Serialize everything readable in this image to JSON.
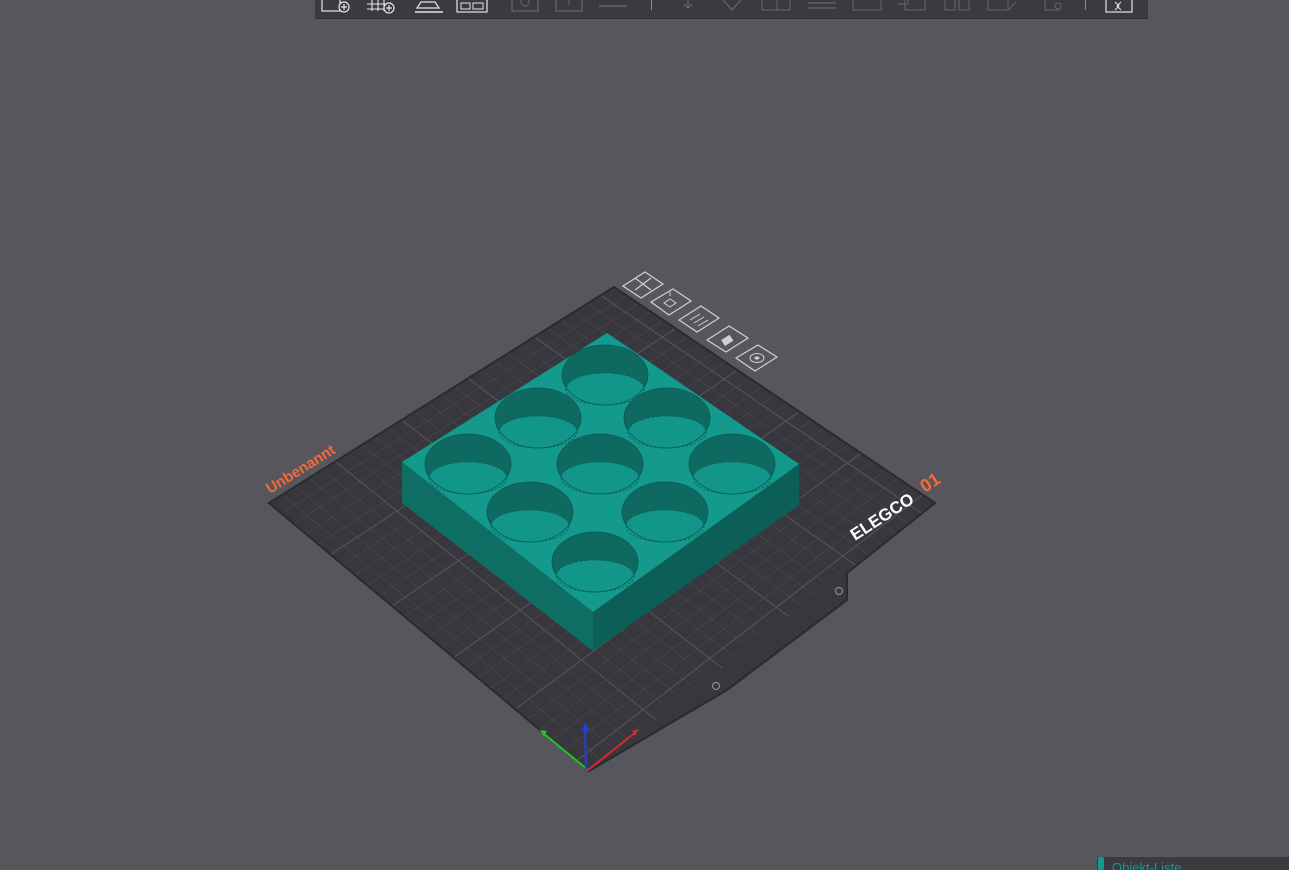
{
  "toolbar": {
    "buttons": [
      {
        "id": "add-object",
        "icon": "add-object-icon",
        "enabled": true
      },
      {
        "id": "add-plate",
        "icon": "add-plate-icon",
        "enabled": true
      },
      {
        "id": "auto-orient",
        "icon": "auto-orient-icon",
        "enabled": true
      },
      {
        "id": "arrange",
        "icon": "arrange-icon",
        "enabled": true
      },
      {
        "id": "add-instance",
        "icon": "add-instance-icon",
        "enabled": false
      },
      {
        "id": "remove-instance",
        "icon": "remove-instance-icon",
        "enabled": false
      },
      {
        "id": "split",
        "icon": "split-icon",
        "enabled": false
      },
      {
        "id": "move",
        "icon": "move-icon",
        "enabled": false
      },
      {
        "id": "rotate",
        "icon": "rotate-icon",
        "enabled": false
      },
      {
        "id": "scale",
        "icon": "scale-icon",
        "enabled": false
      },
      {
        "id": "lay-on-face",
        "icon": "lay-on-face-icon",
        "enabled": false
      },
      {
        "id": "cut",
        "icon": "cut-icon",
        "enabled": false
      },
      {
        "id": "support-paint",
        "icon": "support-paint-icon",
        "enabled": false
      },
      {
        "id": "seam-paint",
        "icon": "seam-paint-icon",
        "enabled": false
      },
      {
        "id": "color-paint",
        "icon": "color-paint-icon",
        "enabled": false
      },
      {
        "id": "text",
        "icon": "text-icon",
        "enabled": false
      },
      {
        "id": "assembly-view",
        "icon": "assembly-view-icon",
        "enabled": true
      }
    ]
  },
  "plate": {
    "name": "Unbenannt",
    "brand": "ELEGCO",
    "number": "01",
    "colors": {
      "plate": "#38373d",
      "grid": "#4a4950",
      "label": "#f26b3a",
      "brand": "#ffffff"
    }
  },
  "plate_tools": [
    {
      "id": "delete-plate",
      "icon": "close-icon"
    },
    {
      "id": "orient-plate",
      "icon": "orient-icon"
    },
    {
      "id": "arrange-plate",
      "icon": "arrange-icon"
    },
    {
      "id": "lock-plate",
      "icon": "lock-icon"
    },
    {
      "id": "plate-settings",
      "icon": "settings-icon"
    }
  ],
  "model": {
    "color": "#139a8c",
    "holes": 9
  },
  "object_list": {
    "label": "Objekt-Liste"
  }
}
